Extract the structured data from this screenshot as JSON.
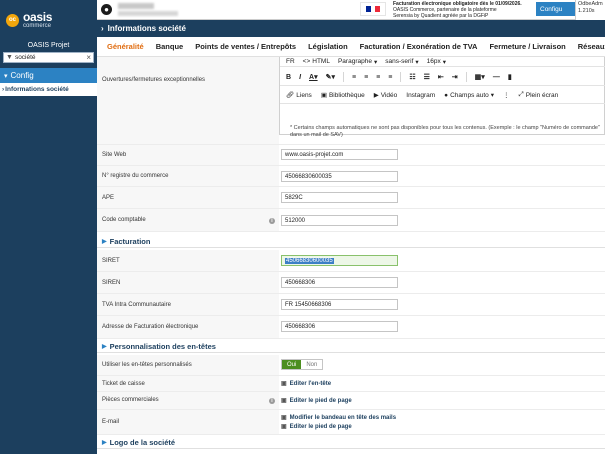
{
  "sidebar": {
    "logo_mark": "oc",
    "logo_main": "oasis",
    "logo_sub": "commerce",
    "project": "OASIS Projet",
    "search_value": "société",
    "nav_config": "Config",
    "nav_info": "Informations société"
  },
  "topbar": {
    "notice_line1": "Facturation électronique obligatoire dès le 01/09/2026.",
    "notice_line2": "OASIS Commerce, partenaire de la plateforme",
    "notice_line3": "Serensia by Quadient agréée par la DGFiP",
    "configure_label": "Configu",
    "user_line1": "OdbeAdm",
    "user_line2": "1.210s"
  },
  "header": {
    "title": "Informations société"
  },
  "tabs": [
    "Généralité",
    "Banque",
    "Points de ventes / Entrepôts",
    "Législation",
    "Facturation / Exonération de TVA",
    "Fermeture / Livraison",
    "Réseaux sociaux"
  ],
  "editor": {
    "label": "Ouvertures/fermetures exceptionnelles",
    "lang": "FR",
    "html_label": "HTML",
    "block_format": "Paragraphe",
    "font_family": "sans-serif",
    "font_size": "16px",
    "links": "Liens",
    "library": "Bibliothèque",
    "video": "Vidéo",
    "instagram": "Instagram",
    "auto_fields": "Champs auto",
    "fullscreen": "Plein écran",
    "note": "* Certains champs automatiques ne sont pas disponibles pour tous les contenus. (Exemple : le champ \"Numéro de commande\" dans un mail de SAV)"
  },
  "fields": {
    "website_label": "Site Web",
    "website_value": "www.oasis-projet.com",
    "rcs_label": "N° registre du commerce",
    "rcs_value": "45066830600035",
    "ape_label": "APE",
    "ape_value": "5829C",
    "accounting_label": "Code comptable",
    "accounting_value": "512000"
  },
  "billing": {
    "section": "Facturation",
    "siret_label": "SIRET",
    "siret_value": "45066830600035",
    "siren_label": "SIREN",
    "siren_value": "450668306",
    "vat_label": "TVA Intra Communautaire",
    "vat_value": "FR 15450668306",
    "einvoice_label": "Adresse de Facturation électronique",
    "einvoice_value": "450668306"
  },
  "headers_section": {
    "section": "Personnalisation des en-têtes",
    "use_label": "Utiliser les en-têtes personnalisés",
    "on": "Oui",
    "off": "Non",
    "receipt_label": "Ticket de caisse",
    "receipt_link": "Editer l'en-tête",
    "commercial_label": "Pièces commerciales",
    "commercial_link": "Editer le pied de page",
    "email_label": "E-mail",
    "email_link1": "Modifier le bandeau en tête des mails",
    "email_link2": "Editer le pied de page"
  },
  "logo_section": {
    "section": "Logo de la société"
  }
}
